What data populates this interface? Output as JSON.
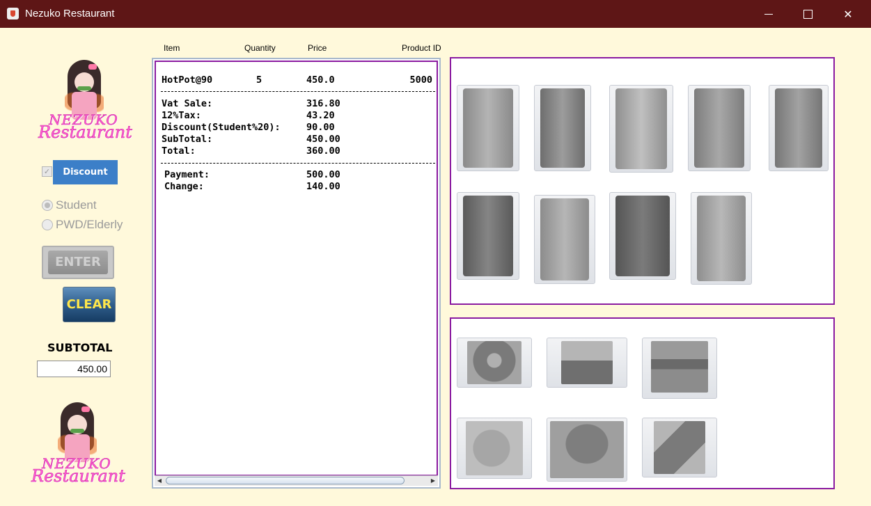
{
  "window": {
    "title": "Nezuko Restaurant",
    "controls": [
      "─",
      "☐",
      "✕"
    ]
  },
  "logo": {
    "line1": "NEZUKO",
    "line2": "Restaurant"
  },
  "columns": {
    "item": "Item",
    "quantity": "Quantity",
    "price": "Price",
    "product_id": "Product ID"
  },
  "discount": {
    "checked": true,
    "label": "Discount"
  },
  "radios": [
    {
      "label": "Student",
      "selected": true
    },
    {
      "label": "PWD/Elderly",
      "selected": false
    }
  ],
  "buttons": {
    "enter": "ENTER",
    "clear": "CLEAR"
  },
  "subtotal": {
    "label": "SUBTOTAL",
    "value": "450.00"
  },
  "receipt": {
    "order": {
      "item": "HotPot@90",
      "quantity": "5",
      "price": "450.0",
      "product_id": "5000"
    },
    "summary": [
      {
        "label": "Vat Sale:",
        "value": "316.80"
      },
      {
        "label": "12%Tax:",
        "value": "43.20"
      },
      {
        "label": "Discount(Student%20):",
        "value": "90.00"
      },
      {
        "label": "SubTotal:",
        "value": "450.00"
      },
      {
        "label": "Total:",
        "value": "360.00"
      }
    ],
    "payment": [
      {
        "label": "Payment:",
        "value": "500.00"
      },
      {
        "label": "Change:",
        "value": "140.00"
      }
    ]
  },
  "products": {
    "drinks": [
      "7up-can",
      "coca-cola-can",
      "diet-coke-can",
      "sprite-can",
      "fanta-can",
      "pepsi-can",
      "diet-pepsi-can",
      "pepsi-black-can",
      "tango-can"
    ],
    "food": [
      "donut",
      "fries",
      "burger",
      "pizza",
      "chili-bowl",
      "hotdog"
    ]
  },
  "colors": {
    "titlebar": "#5e1616",
    "background": "#fff9db",
    "panel_border": "#8a1aa0",
    "discount_button": "#3c7fc8",
    "clear_text": "#ffe74a",
    "logo_text": "#ff5fd0"
  }
}
